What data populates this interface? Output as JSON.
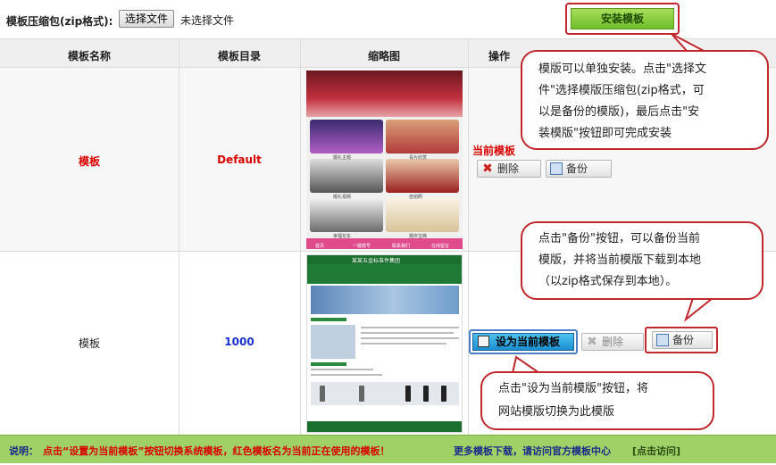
{
  "upload": {
    "label": "模板压缩包(zip格式):",
    "choose_button": "选择文件",
    "no_file": "未选择文件",
    "install_button": "安装模板"
  },
  "table": {
    "headers": [
      "模板名称",
      "模板目录",
      "缩略图",
      "操作"
    ],
    "rows": [
      {
        "name": "模板",
        "dir": "Default",
        "current_label": "当前模板",
        "delete": "删除",
        "backup": "备份"
      },
      {
        "name": "模板",
        "dir": "1000",
        "set_current": "设为当前模板",
        "delete": "删除",
        "backup": "备份"
      }
    ]
  },
  "thumb1": {
    "tiles": [
      "婚礼主题",
      "青片欣赏",
      "婚礼视频",
      "自拍照",
      "幸福花车",
      "婚庆宝典"
    ],
    "nav": [
      "首页",
      "一键拨号",
      "联系我们",
      "在线留言"
    ]
  },
  "thumb2": {
    "company": "某某五金标准件集团"
  },
  "callouts": {
    "install": [
      "模版可以单独安装。点击\"选择文",
      "件\"选择模版压缩包(zip格式，可",
      "以是备份的模版)，最后点击\"安",
      "装模版\"按钮即可完成安装"
    ],
    "backup": [
      "点击\"备份\"按钮，可以备份当前",
      "模版，并将当前模版下载到本地",
      "（以zip格式保存到本地）。"
    ],
    "set_current": [
      "点击\"设为当前模版\"按钮，将",
      "网站模版切换为此模版"
    ]
  },
  "footer": {
    "prefix": "说明：",
    "note": "点击“设置为当前模板”按钮切换系统模板，红色模板名为当前正在使用的模板！",
    "more": "更多模板下载，请访问官方模板中心",
    "link": "[点击访问]"
  },
  "colors": {
    "callout_border": "#c0282d",
    "current_red": "#d90000",
    "dir_blue": "#1a2fd0",
    "footer_green": "#9fd166"
  }
}
